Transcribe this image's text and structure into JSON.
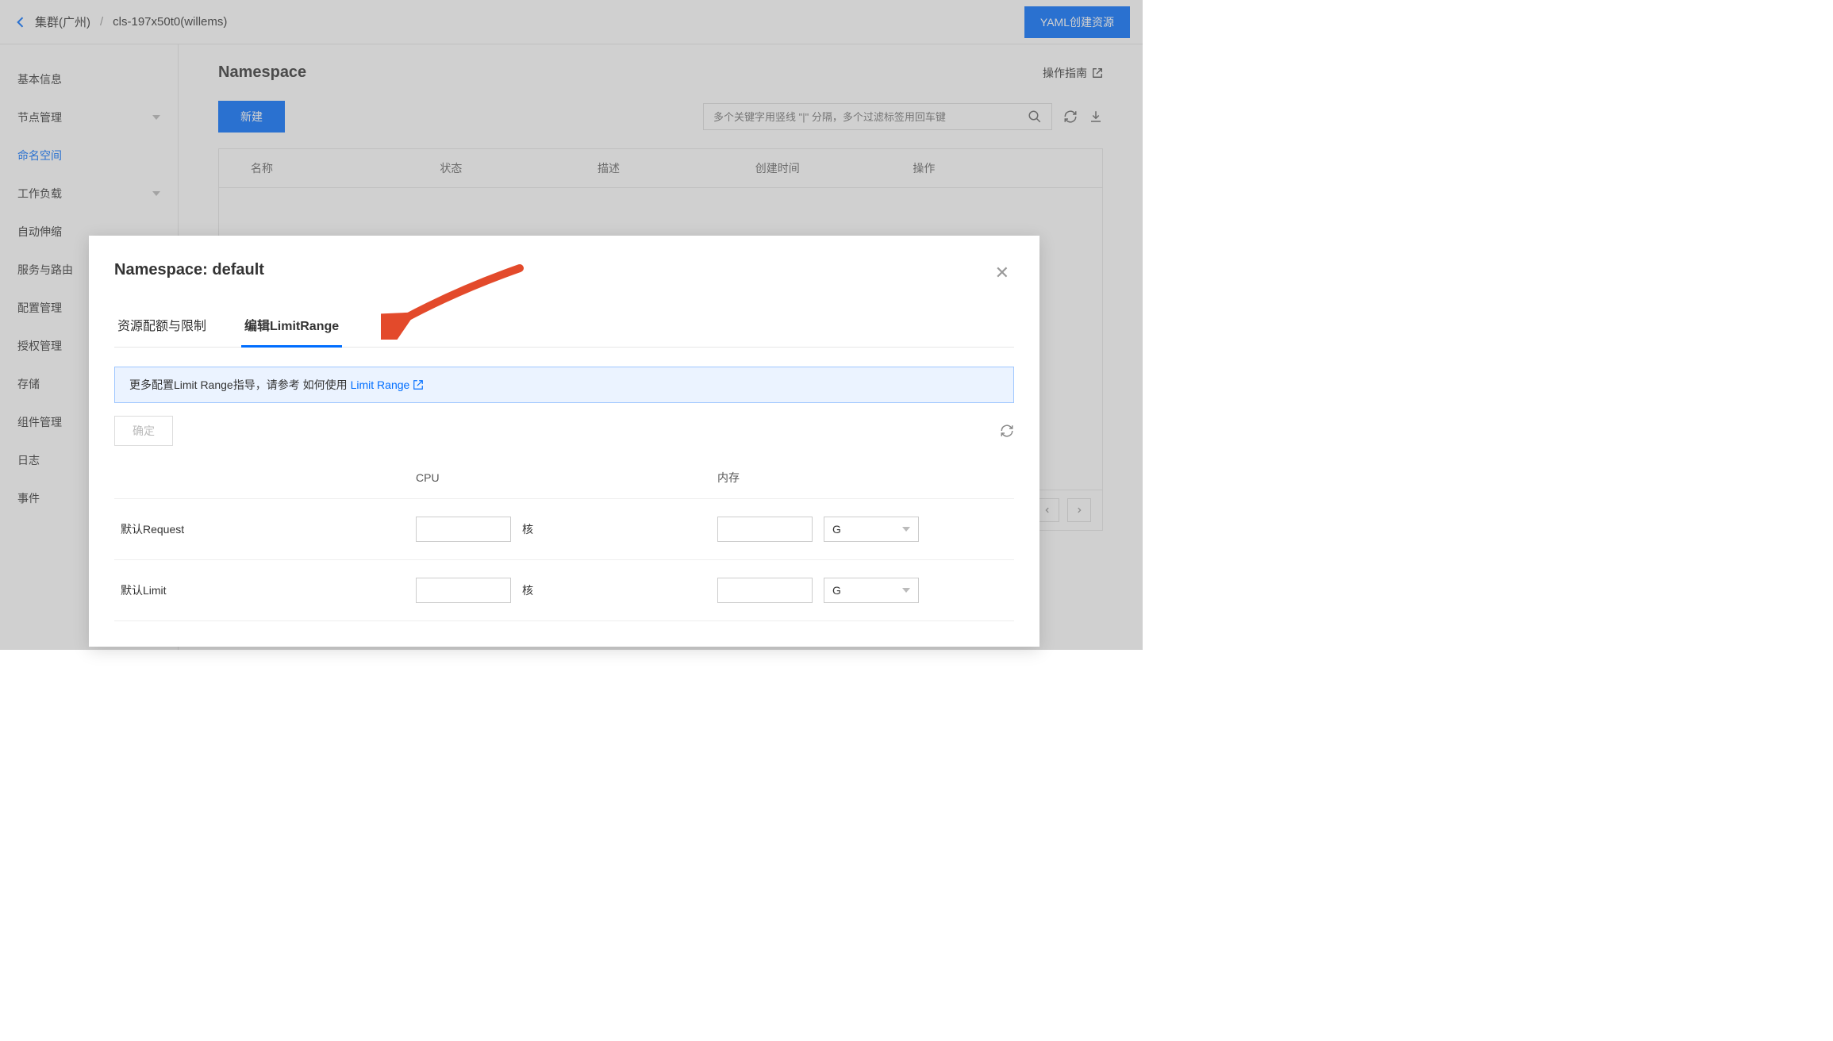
{
  "breadcrumb": {
    "cluster": "集群(广州)",
    "cluster_id": "cls-197x50t0(willems)"
  },
  "header": {
    "yaml_create": "YAML创建资源"
  },
  "sidebar": {
    "items": [
      {
        "label": "基本信息",
        "expandable": false
      },
      {
        "label": "节点管理",
        "expandable": true
      },
      {
        "label": "命名空间",
        "expandable": false
      },
      {
        "label": "工作负载",
        "expandable": true
      },
      {
        "label": "自动伸缩",
        "expandable": false
      },
      {
        "label": "服务与路由",
        "expandable": false
      },
      {
        "label": "配置管理",
        "expandable": false
      },
      {
        "label": "授权管理",
        "expandable": false
      },
      {
        "label": "存储",
        "expandable": false
      },
      {
        "label": "组件管理",
        "expandable": false
      },
      {
        "label": "日志",
        "expandable": false
      },
      {
        "label": "事件",
        "expandable": false
      }
    ],
    "active_index": 2
  },
  "main": {
    "title": "Namespace",
    "op_guide": "操作指南",
    "new_btn": "新建",
    "search_placeholder": "多个关键字用竖线 \"|\" 分隔，多个过滤标签用回车键",
    "columns": {
      "name": "名称",
      "status": "状态",
      "desc": "描述",
      "created": "创建时间",
      "ops": "操作"
    }
  },
  "modal": {
    "title": "Namespace: default",
    "tabs": {
      "quota": "资源配额与限制",
      "limit_range": "编辑LimitRange"
    },
    "banner": {
      "prefix": "更多配置Limit Range指导，请参考 如何使用",
      "link": "Limit Range"
    },
    "confirm": "确定",
    "table_head": {
      "cpu": "CPU",
      "mem": "内存"
    },
    "row_request_label": "默认Request",
    "row_limit_label": "默认Limit",
    "cpu_unit": "核",
    "mem_unit_selected": "G"
  }
}
